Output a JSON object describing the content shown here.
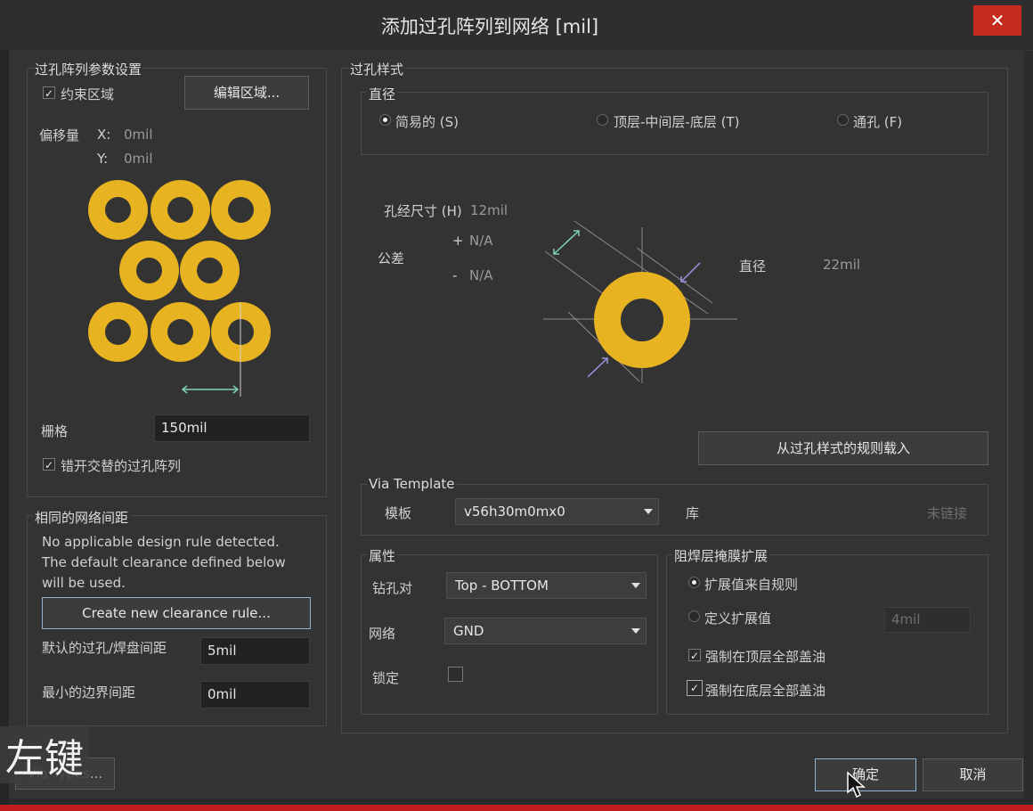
{
  "window": {
    "title": "添加过孔阵列到网络 [mil]",
    "close": "✕"
  },
  "array_params": {
    "group_label": "过孔阵列参数设置",
    "constrain_label": "约束区域",
    "constrain_checked": true,
    "edit_region_button": "编辑区域...",
    "offset_label": "偏移量",
    "offset_x_label": "X:",
    "offset_x_value": "0mil",
    "offset_y_label": "Y:",
    "offset_y_value": "0mil",
    "grid_label": "栅格",
    "grid_value": "150mil",
    "stagger_label": "错开交替的过孔阵列",
    "stagger_checked": true
  },
  "clearance": {
    "group_label": "相同的网络间距",
    "message_1": "No applicable design rule detected.",
    "message_2": "The default clearance defined below",
    "message_3": "will be used.",
    "create_rule_button": "Create new clearance rule...",
    "via_pad_label": "默认的过孔/焊盘间距",
    "via_pad_value": "5mil",
    "min_edge_label": "最小的边界间距",
    "min_edge_value": "0mil"
  },
  "via_style": {
    "group_label": "过孔样式",
    "diameter_group_label": "直径",
    "radio_simple": "简易的 (S)",
    "radio_tmb": "顶层-中间层-底层 (T)",
    "radio_full": "通孔 (F)",
    "selected_radio": "simple",
    "hole_size_label": "孔经尺寸 (H)",
    "hole_size_value": "12mil",
    "tolerance_label": "公差",
    "tol_plus_sign": "+",
    "tol_plus_value": "N/A",
    "tol_minus_sign": "-",
    "tol_minus_value": "N/A",
    "diameter_label": "直径",
    "diameter_value": "22mil",
    "load_rule_button": "从过孔样式的规则载入"
  },
  "via_template": {
    "group_label": "Via Template",
    "template_label": "模板",
    "template_value": "v56h30m0mx0",
    "library_label": "库",
    "library_status": "未链接"
  },
  "properties": {
    "group_label": "属性",
    "drill_pair_label": "钻孔对",
    "drill_pair_value": "Top - BOTTOM",
    "net_label": "网络",
    "net_value": "GND",
    "lock_label": "锁定",
    "lock_checked": false
  },
  "solder_mask": {
    "group_label": "阻焊层掩膜扩展",
    "from_rule_label": "扩展值来自规则",
    "custom_label": "定义扩展值",
    "custom_value": "4mil",
    "selected": "from_rule",
    "tent_top_label": "强制在顶层全部盖油",
    "tent_top_checked": true,
    "tent_bottom_label": "强制在底层全部盖油",
    "tent_bottom_checked": true
  },
  "footer": {
    "via_types_button": "Via Types...",
    "ok_button": "确定",
    "cancel_button": "取消"
  },
  "overlay": {
    "caption": "左键"
  },
  "colors": {
    "via_copper": "#e8b321",
    "dialog_bg": "#333333",
    "close_red": "#c42b1c"
  }
}
